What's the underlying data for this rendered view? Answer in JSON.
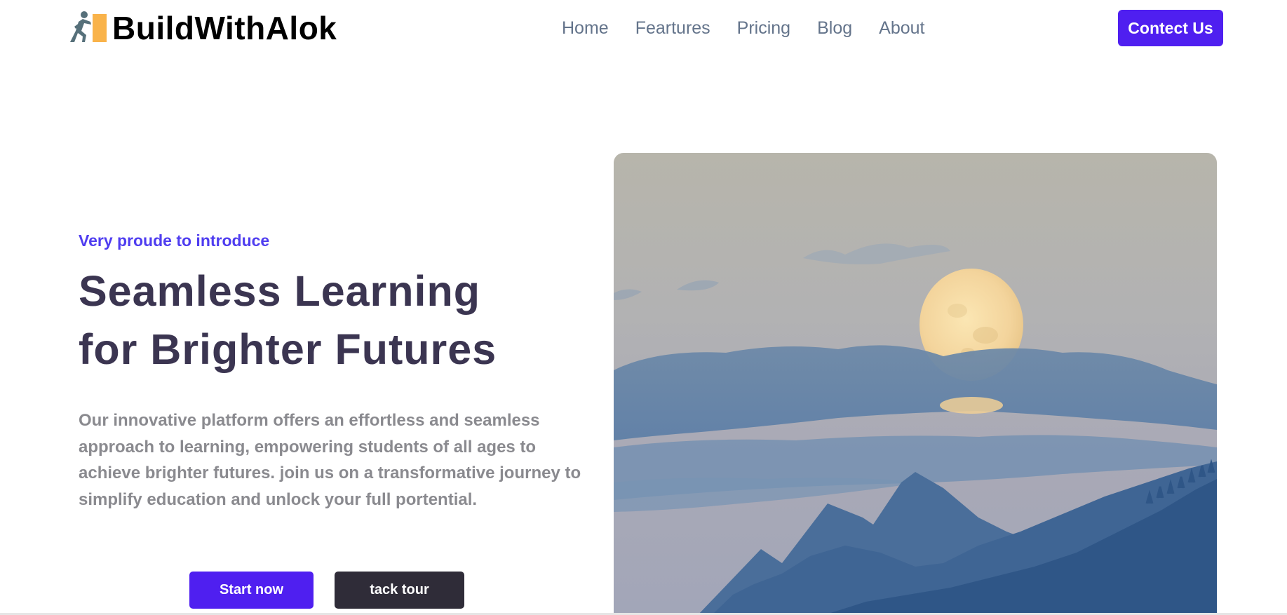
{
  "header": {
    "brand_name": "BuildWithAlok",
    "logo_icon": "person-pushing-block-icon",
    "nav": [
      {
        "label": "Home"
      },
      {
        "label": "Feartures"
      },
      {
        "label": "Pricing"
      },
      {
        "label": "Blog"
      },
      {
        "label": "About"
      }
    ],
    "contact_label": "Contect Us"
  },
  "hero": {
    "eyebrow": "Very proude to introduce",
    "title_line1": "Seamless Learning",
    "title_line2": "for Brighter Futures",
    "description": "Our innovative platform offers an effortless and seamless approach to learning, empowering students of all ages to achieve brighter futures. join us on a transformative journey to simplify education and unlock your full portential.",
    "start_label": "Start now",
    "tour_label": "tack tour",
    "image_subject": "full moon over mountains at dusk"
  },
  "colors": {
    "accent": "#4f1ff0",
    "eyebrow": "#4f3df0",
    "title": "#3b3551",
    "description": "#8a8a8f",
    "nav": "#64748b",
    "tour_button": "#2f2c38",
    "logo_orange": "#f9b34a",
    "logo_figure": "#56707a"
  }
}
